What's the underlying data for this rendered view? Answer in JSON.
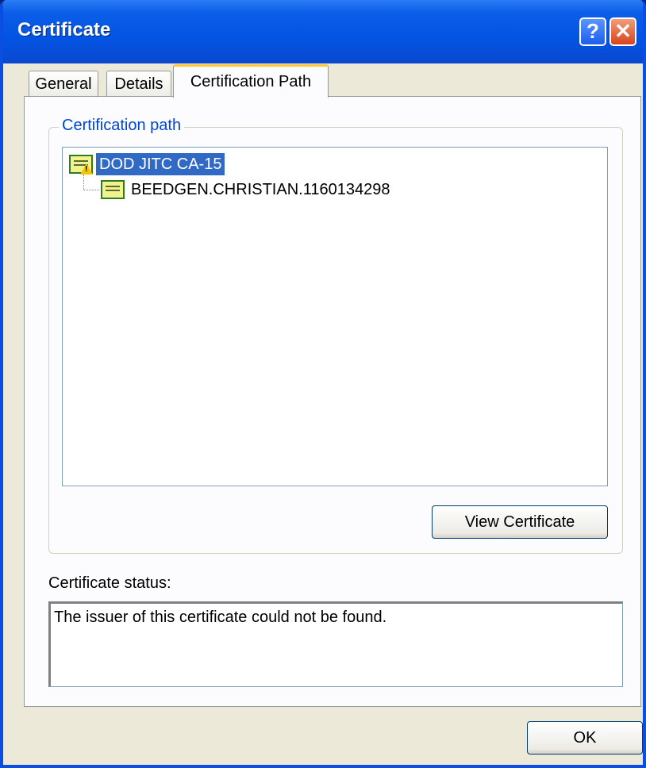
{
  "window": {
    "title": "Certificate",
    "help_glyph": "?",
    "close_glyph": "✕"
  },
  "tabs": [
    {
      "label": "General",
      "active": false
    },
    {
      "label": "Details",
      "active": false
    },
    {
      "label": "Certification Path",
      "active": true
    }
  ],
  "certification_path": {
    "group_label": "Certification path",
    "nodes": [
      {
        "label": "DOD JITC CA-15",
        "selected": true,
        "icon": "certificate-warning-icon"
      },
      {
        "label": "BEEDGEN.CHRISTIAN.1160134298",
        "selected": false,
        "icon": "certificate-icon"
      }
    ],
    "view_button_label": "View Certificate"
  },
  "status": {
    "label": "Certificate status:",
    "text": "The issuer of this certificate could not be found."
  },
  "footer": {
    "ok_label": "OK"
  },
  "colors": {
    "titlebar": "#0354e3",
    "selection": "#316ac5",
    "group_title": "#0046d5",
    "active_tab_accent": "#ffc83c"
  }
}
